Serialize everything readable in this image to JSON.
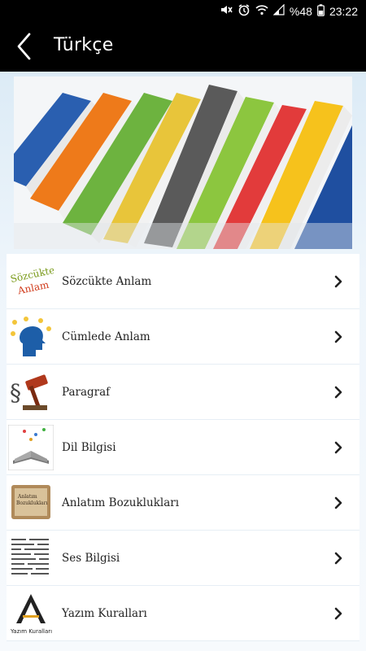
{
  "status_bar": {
    "battery": "%48",
    "time": "23:22",
    "icons": [
      "mute-icon",
      "alarm-icon",
      "wifi-icon",
      "signal-icon",
      "battery-icon"
    ]
  },
  "app_bar": {
    "title": "Türkçe",
    "back_icon": "chevron-left-icon"
  },
  "banner": {
    "image": "colorful-books-banner"
  },
  "menu": {
    "items": [
      {
        "label": "Sözcükte Anlam",
        "thumb_text": "Sözcükte Anlam"
      },
      {
        "label": "Cümlede Anlam",
        "thumb_text": ""
      },
      {
        "label": "Paragraf",
        "thumb_text": "§"
      },
      {
        "label": "Dil Bilgisi",
        "thumb_text": ""
      },
      {
        "label": "Anlatım Bozuklukları",
        "thumb_text": "Anlatım Bozuklukları"
      },
      {
        "label": "Ses Bilgisi",
        "thumb_text": ""
      },
      {
        "label": "Yazım Kuralları",
        "thumb_text": "Yazım Kuralları"
      }
    ]
  },
  "colors": {
    "app_bar_bg": "#000000",
    "content_bg": "#e6f0f8"
  }
}
